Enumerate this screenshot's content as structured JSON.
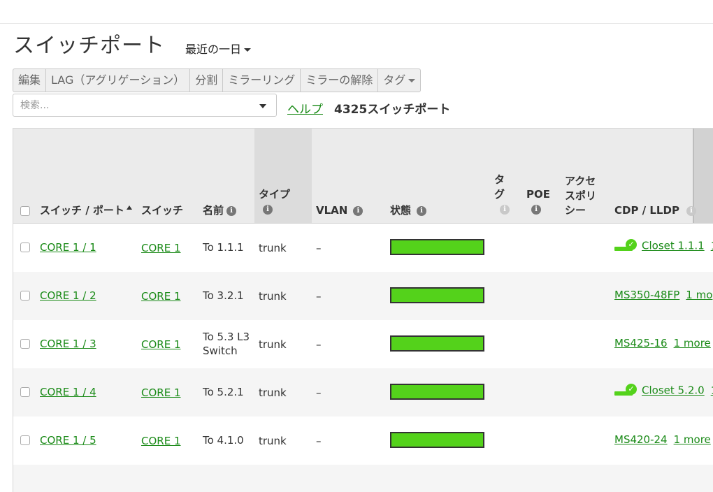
{
  "page": {
    "title": "スイッチポート",
    "period": "最近の一日"
  },
  "toolbar": {
    "edit": "編集",
    "lag": "LAG（アグリゲーション）",
    "split": "分割",
    "mirror": "ミラーリング",
    "unmirror": "ミラーの解除",
    "tags": "タグ"
  },
  "search": {
    "placeholder": "検索...",
    "value": ""
  },
  "help_link": "ヘルプ",
  "port_count": "4325スイッチポート",
  "colors": {
    "accent_link": "#1a8a17",
    "status_ok": "#54d21b"
  },
  "table": {
    "headers": {
      "switch_port": "スイッチ / ポート",
      "switch": "スイッチ",
      "name": "名前",
      "type": "タイプ",
      "vlan": "VLAN",
      "status": "状態",
      "tags_line1": "タ",
      "tags_line2": "グ",
      "poe": "POE",
      "access_line1": "アクセ",
      "access_line2": "スポリ",
      "access_line3": "シー",
      "cdp_lldp": "CDP / LLDP"
    },
    "rows": [
      {
        "port": "CORE 1 / 1",
        "switch": "CORE 1",
        "name": "To 1.1.1",
        "name2": "",
        "type": "trunk",
        "vlan": "–",
        "status": "ok",
        "cdp_icon": "switch-ok-icon",
        "cdp_main": "Closet 1.1.1",
        "cdp_extra": "1"
      },
      {
        "port": "CORE 1 / 2",
        "switch": "CORE 1",
        "name": "To 3.2.1",
        "name2": "",
        "type": "trunk",
        "vlan": "–",
        "status": "ok",
        "cdp_icon": "",
        "cdp_main": "MS350-48FP",
        "cdp_extra": "1 mo"
      },
      {
        "port": "CORE 1 / 3",
        "switch": "CORE 1",
        "name": "To 5.3 L3",
        "name2": "Switch",
        "type": "trunk",
        "vlan": "–",
        "status": "ok",
        "cdp_icon": "",
        "cdp_main": "MS425-16",
        "cdp_extra": "1 more"
      },
      {
        "port": "CORE 1 / 4",
        "switch": "CORE 1",
        "name": "To 5.2.1",
        "name2": "",
        "type": "trunk",
        "vlan": "–",
        "status": "ok",
        "cdp_icon": "switch-ok-icon",
        "cdp_main": "Closet 5.2.0",
        "cdp_extra": "1"
      },
      {
        "port": "CORE 1 / 5",
        "switch": "CORE 1",
        "name": "To 4.1.0",
        "name2": "",
        "type": "trunk",
        "vlan": "–",
        "status": "ok",
        "cdp_icon": "",
        "cdp_main": "MS420-24",
        "cdp_extra": "1 more"
      }
    ]
  }
}
